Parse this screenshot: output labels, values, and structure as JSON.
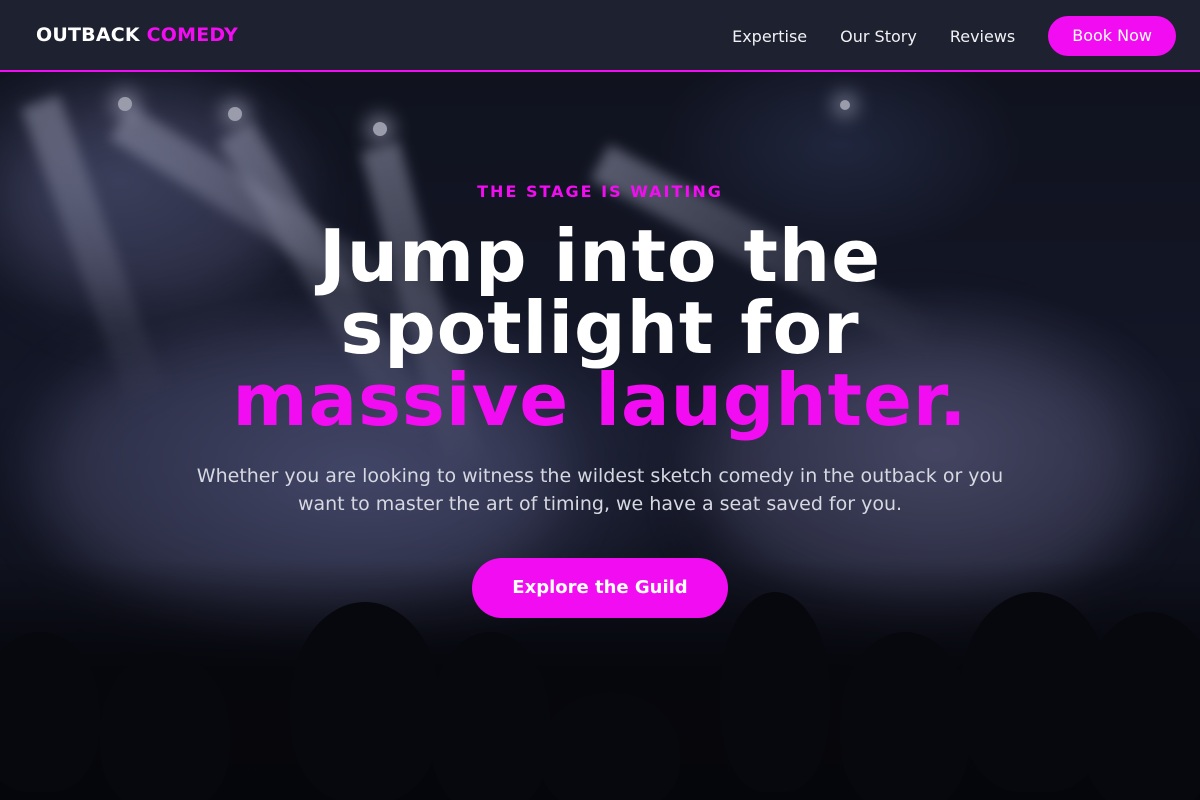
{
  "brand": {
    "name_primary": "OUTBACK",
    "name_accent": "COMEDY",
    "accent_color": "#f20cf2",
    "header_bg": "#1d2130"
  },
  "nav": {
    "links": [
      "Expertise",
      "Our Story",
      "Reviews"
    ],
    "cta_label": "Book Now"
  },
  "hero": {
    "eyebrow": "THE STAGE IS WAITING",
    "headline_line1": "Jump into the",
    "headline_line2": "spotlight for",
    "headline_highlight": "massive laughter.",
    "subtitle": "Whether you are looking to witness the wildest sketch comedy in the outback or you want to master the art of timing, we have a seat saved for you.",
    "cta_label": "Explore the Guild",
    "background": "concert-stage-photo"
  }
}
